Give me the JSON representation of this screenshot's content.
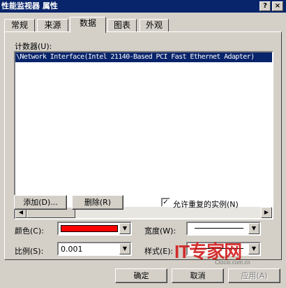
{
  "window": {
    "title": "性能监视器 属性",
    "help_button": "?",
    "close_button": "×"
  },
  "tabs": [
    {
      "label": "常规",
      "active": false
    },
    {
      "label": "来源",
      "active": false
    },
    {
      "label": "数据",
      "active": true
    },
    {
      "label": "图表",
      "active": false
    },
    {
      "label": "外观",
      "active": false
    }
  ],
  "counters": {
    "label": "计数器(U):",
    "items": [
      "\\Network Interface(Intel 21140-Based PCI Fast Ethernet Adapter)"
    ]
  },
  "buttons": {
    "add": "添加(D)...",
    "remove": "删除(R)"
  },
  "allow_duplicates": {
    "label": "允许重复的实例(N)",
    "checked": true,
    "check_glyph": "✓"
  },
  "fields": {
    "color_label": "颜色(C):",
    "color_value": "#ff0000",
    "width_label": "宽度(W):",
    "scale_label": "比例(S):",
    "scale_value": "0.001",
    "style_label": "样式(E):"
  },
  "footer": {
    "ok": "确定",
    "cancel": "取消",
    "apply": "应用(A)"
  },
  "watermark": {
    "logo": "IT专家网",
    "site": "Ctocio.com.cn"
  }
}
